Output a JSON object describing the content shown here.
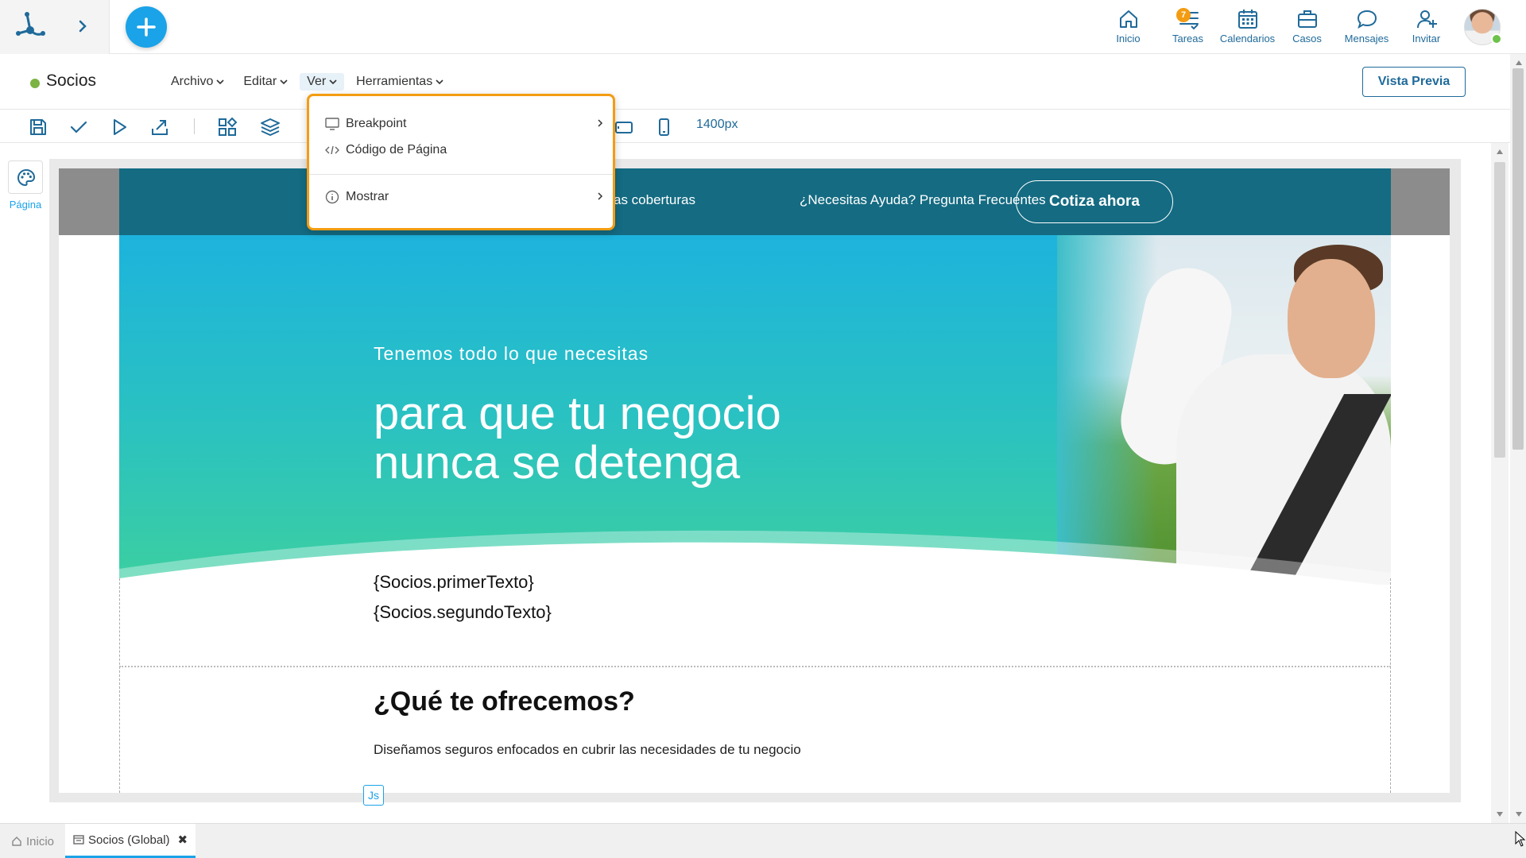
{
  "topnav": {
    "items": [
      {
        "label": "Inicio",
        "icon": "home-icon"
      },
      {
        "label": "Tareas",
        "icon": "tasks-icon",
        "badge": "7"
      },
      {
        "label": "Calendarios",
        "icon": "calendar-icon"
      },
      {
        "label": "Casos",
        "icon": "briefcase-icon"
      },
      {
        "label": "Mensajes",
        "icon": "chat-icon"
      },
      {
        "label": "Invitar",
        "icon": "invite-icon"
      }
    ]
  },
  "menubar": {
    "title": "Socios",
    "items": [
      "Archivo",
      "Editar",
      "Ver",
      "Herramientas"
    ],
    "active": "Ver",
    "preview_label": "Vista Previa"
  },
  "toolbar": {
    "breakpoint_value": "1400px"
  },
  "left_panel": {
    "label": "Página"
  },
  "dropdown": {
    "items": [
      {
        "label": "Breakpoint",
        "icon": "monitor-icon",
        "submenu": true
      },
      {
        "label": "Código de Página",
        "icon": "code-icon",
        "submenu": false
      },
      {
        "label": "Mostrar",
        "icon": "info-icon",
        "submenu": true
      }
    ]
  },
  "site": {
    "nav_link_1": "as coberturas",
    "nav_link_2": "¿Necesitas Ayuda? Pregunta Frecuentes",
    "cta": "Cotiza ahora",
    "hero_subtitle": "Tenemos todo lo que necesitas",
    "hero_title_line1": "para que tu negocio",
    "hero_title_line2": "nunca se detenga",
    "var1": "{Socios.primerTexto}",
    "var2": "{Socios.segundoTexto}",
    "section_title": "¿Qué te ofrecemos?",
    "section_text": "Diseñamos seguros enfocados en cubrir las necesidades de tu negocio",
    "js_badge": "Js"
  },
  "bottom_tabs": {
    "home": "Inicio",
    "active": "Socios (Global)",
    "close": "✖"
  },
  "colors": {
    "accent": "#1aa3e8",
    "brand_dark": "#1f6a9a",
    "dropdown_border": "#f39c12",
    "status_green": "#7cb342",
    "header_teal": "#146b82"
  }
}
